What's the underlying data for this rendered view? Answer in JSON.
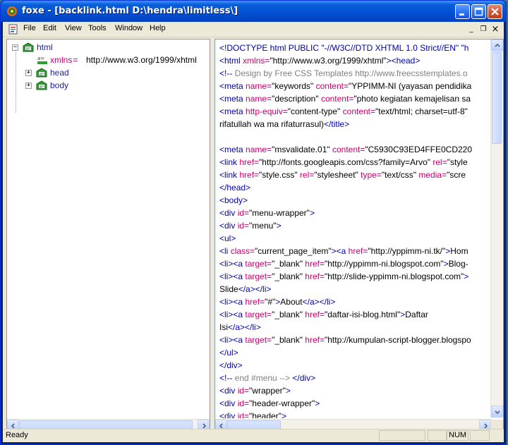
{
  "window": {
    "title": "foxe - [backlink.html  D:\\hendra\\limitless\\]",
    "app_icon": "foxe-app-icon"
  },
  "menu": {
    "items": [
      "File",
      "Edit",
      "View",
      "Tools",
      "Window",
      "Help"
    ],
    "mdi_minimize": "_",
    "mdi_restore": "❐",
    "mdi_close": "×"
  },
  "tree": {
    "root": "html",
    "attr_name": "xmlns",
    "attr_eq": " = ",
    "attr_value": "http://www.w3.org/1999/xhtml",
    "children": [
      "head",
      "body"
    ],
    "toggle_expanded": "−",
    "toggle_collapsed": "+"
  },
  "source": {
    "lines": [
      [
        [
          "t",
          "<!DOCTYPE html PUBLIC \"-//W3C//DTD XHTML 1.0 Strict//EN\" \"h"
        ]
      ],
      [
        [
          "t",
          "<html "
        ],
        [
          "a",
          "xmlns="
        ],
        [
          "v",
          "\"http://www.w3.org/1999/xhtml\""
        ],
        [
          "t",
          "><head>"
        ]
      ],
      [
        [
          "t",
          "<!-- "
        ],
        [
          "c",
          "Design by Free CSS Templates http://www.freecsstemplates.o"
        ]
      ],
      [
        [
          "t",
          "<meta "
        ],
        [
          "a",
          "name="
        ],
        [
          "v",
          "\"keywords\" "
        ],
        [
          "a",
          "content="
        ],
        [
          "v",
          "\"YPPIMM-NI (yayasan pendidika"
        ]
      ],
      [
        [
          "t",
          "<meta "
        ],
        [
          "a",
          "name="
        ],
        [
          "v",
          "\"description\" "
        ],
        [
          "a",
          "content="
        ],
        [
          "v",
          "\"photo kegiatan kemajelisan sa"
        ]
      ],
      [
        [
          "t",
          "<meta "
        ],
        [
          "a",
          "http-equiv="
        ],
        [
          "v",
          "\"content-type\" "
        ],
        [
          "a",
          "content="
        ],
        [
          "v",
          "\"text/html; charset=utf-8\""
        ]
      ],
      [
        [
          "v",
          "rifatullah wa ma rifaturrasul)"
        ],
        [
          "t",
          "</title>"
        ]
      ],
      [],
      [
        [
          "t",
          "<meta "
        ],
        [
          "a",
          "name="
        ],
        [
          "v",
          "\"msvalidate.01\" "
        ],
        [
          "a",
          "content="
        ],
        [
          "v",
          "\"C5930C93ED4FFE0CD220"
        ]
      ],
      [
        [
          "t",
          "<link "
        ],
        [
          "a",
          "href="
        ],
        [
          "v",
          "\"http://fonts.googleapis.com/css?family=Arvo\" "
        ],
        [
          "a",
          "rel="
        ],
        [
          "v",
          "\"style"
        ]
      ],
      [
        [
          "t",
          "<link "
        ],
        [
          "a",
          "href="
        ],
        [
          "v",
          "\"style.css\" "
        ],
        [
          "a",
          "rel="
        ],
        [
          "v",
          "\"stylesheet\" "
        ],
        [
          "a",
          "type="
        ],
        [
          "v",
          "\"text/css\" "
        ],
        [
          "a",
          "media="
        ],
        [
          "v",
          "\"scre"
        ]
      ],
      [
        [
          "t",
          "</head>"
        ]
      ],
      [
        [
          "t",
          "<body>"
        ]
      ],
      [
        [
          "t",
          "<div "
        ],
        [
          "a",
          "id="
        ],
        [
          "v",
          "\"menu-wrapper\""
        ],
        [
          "t",
          ">"
        ]
      ],
      [
        [
          "t",
          "<div "
        ],
        [
          "a",
          "id="
        ],
        [
          "v",
          "\"menu\""
        ],
        [
          "t",
          ">"
        ]
      ],
      [
        [
          "t",
          "<ul>"
        ]
      ],
      [
        [
          "t",
          "<li "
        ],
        [
          "a",
          "class="
        ],
        [
          "v",
          "\"current_page_item\""
        ],
        [
          "t",
          "><a "
        ],
        [
          "a",
          "href="
        ],
        [
          "v",
          "\"http://yppimm-ni.tk/\""
        ],
        [
          "t",
          ">"
        ],
        [
          "v",
          "Hom"
        ]
      ],
      [
        [
          "t",
          "<li><a "
        ],
        [
          "a",
          "target="
        ],
        [
          "v",
          "\"_blank\" "
        ],
        [
          "a",
          "href="
        ],
        [
          "v",
          "\"http://yppimm-ni.blogspot.com\""
        ],
        [
          "t",
          ">"
        ],
        [
          "v",
          "Blog-"
        ]
      ],
      [
        [
          "t",
          "<li><a "
        ],
        [
          "a",
          "target="
        ],
        [
          "v",
          "\"_blank\" "
        ],
        [
          "a",
          "href="
        ],
        [
          "v",
          "\"http://slide-yppimm-ni.blogspot.com\""
        ],
        [
          "t",
          ">"
        ]
      ],
      [
        [
          "v",
          "Slide"
        ],
        [
          "t",
          "</a></li>"
        ]
      ],
      [
        [
          "t",
          "<li><a "
        ],
        [
          "a",
          "href="
        ],
        [
          "v",
          "\"#\""
        ],
        [
          "t",
          ">"
        ],
        [
          "v",
          "About"
        ],
        [
          "t",
          "</a></li>"
        ]
      ],
      [
        [
          "t",
          "<li><a "
        ],
        [
          "a",
          "target="
        ],
        [
          "v",
          "\"_blank\" "
        ],
        [
          "a",
          "href="
        ],
        [
          "v",
          "\"daftar-isi-blog.html\""
        ],
        [
          "t",
          ">"
        ],
        [
          "v",
          "Daftar"
        ]
      ],
      [
        [
          "v",
          "Isi"
        ],
        [
          "t",
          "</a></li>"
        ]
      ],
      [
        [
          "t",
          "<li><a "
        ],
        [
          "a",
          "target="
        ],
        [
          "v",
          "\"_blank\" "
        ],
        [
          "a",
          "href="
        ],
        [
          "v",
          "\"http://kumpulan-script-blogger.blogspo"
        ]
      ],
      [
        [
          "t",
          "</ul>"
        ]
      ],
      [
        [
          "t",
          "</div>"
        ]
      ],
      [
        [
          "t",
          "<!-- "
        ],
        [
          "c",
          "end #menu --> "
        ],
        [
          "t",
          "</div>"
        ]
      ],
      [
        [
          "t",
          "<div "
        ],
        [
          "a",
          "id="
        ],
        [
          "v",
          "\"wrapper\""
        ],
        [
          "t",
          ">"
        ]
      ],
      [
        [
          "t",
          "<div "
        ],
        [
          "a",
          "id="
        ],
        [
          "v",
          "\"header-wrapper\""
        ],
        [
          "t",
          ">"
        ]
      ],
      [
        [
          "t",
          "<div "
        ],
        [
          "a",
          "id="
        ],
        [
          "v",
          "\"header\""
        ],
        [
          "t",
          ">"
        ]
      ]
    ]
  },
  "status": {
    "text": "Ready",
    "num": "NUM"
  },
  "colors": {
    "tag": "#0000aa",
    "attribute": "#c8006e",
    "comment": "#808080",
    "tree_label": "#1a1ab0"
  }
}
